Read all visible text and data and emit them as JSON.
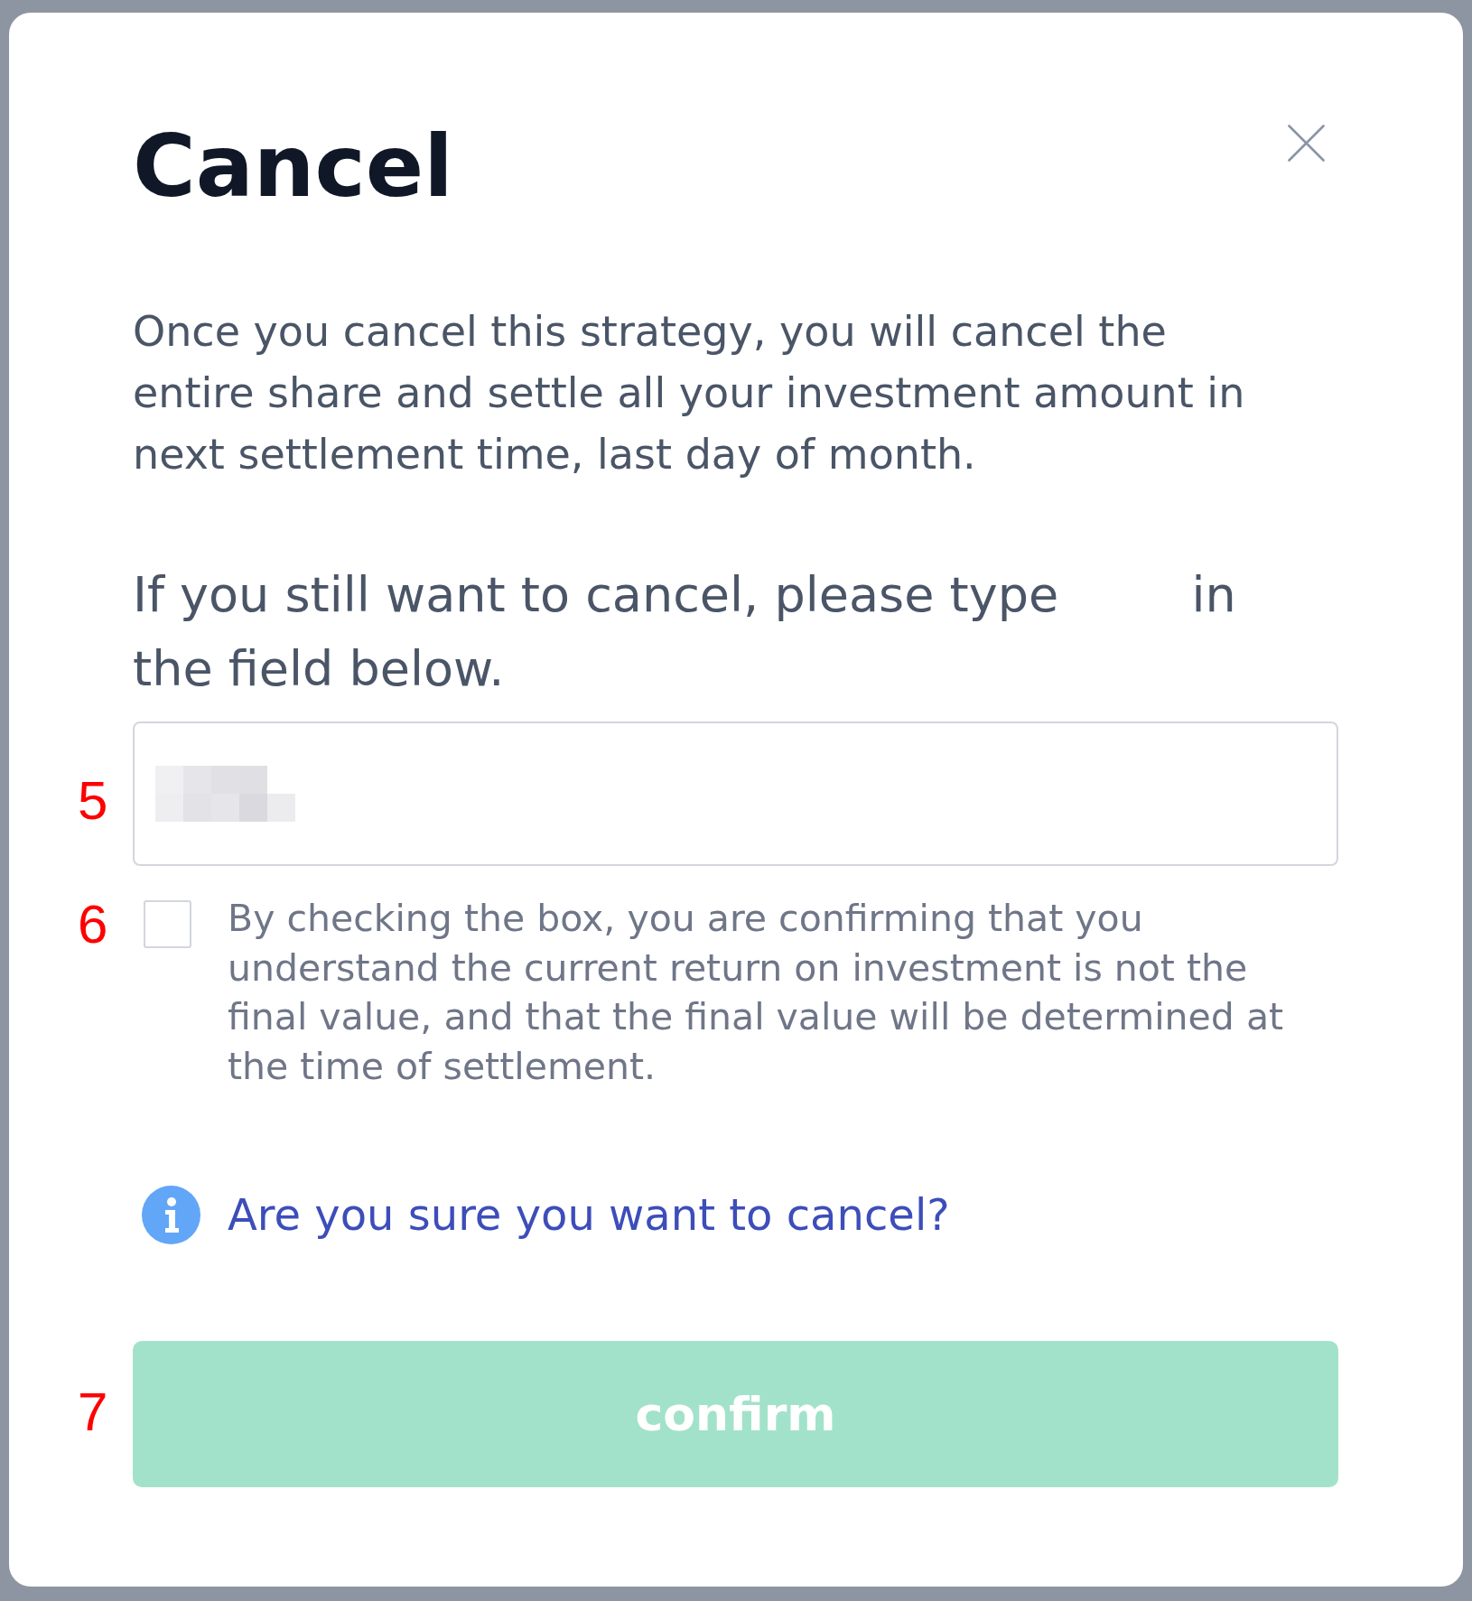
{
  "dialog": {
    "title": "Cancel"
  },
  "message": "Once you cancel this strategy, you will cancel the entire share and settle all your investment amount in next settlement time, last day of month.",
  "prompt": {
    "text_before": "If you still want to cancel, please type",
    "text_after": "in the field below."
  },
  "field": {
    "placeholder_pixelated": true,
    "annotation": "5"
  },
  "agreement": {
    "checked": false,
    "text": "By checking the box, you are confirming that you understand the current return on investment is not the final value, and that the final value will be determined at the time of settlement.",
    "annotation": "6"
  },
  "notice": {
    "text": "Are you sure you want to cancel?"
  },
  "confirm_button": {
    "label": "confirm",
    "disabled": true,
    "annotation": "7"
  }
}
